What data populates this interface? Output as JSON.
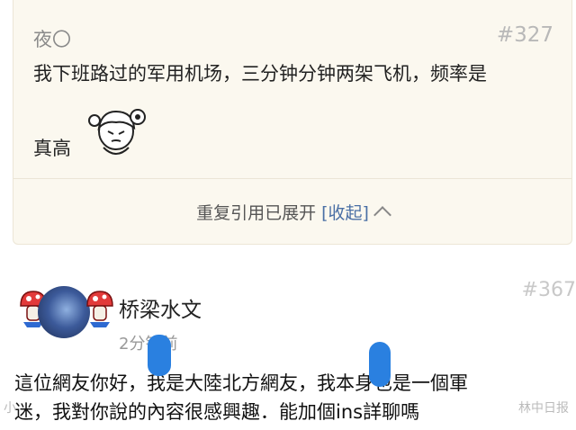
{
  "quote": {
    "user": "夜〇",
    "floor": "#327",
    "line1": "我下班路过的军用机场，三分钟分钟两架飞机，频率是",
    "line2": "真高",
    "toggle_text": "重复引用已展开",
    "collapse_label": "[收起]",
    "sticker_icon": "cartoon-girl-sticker"
  },
  "reply": {
    "user": "桥梁水文",
    "time": "2分钟前",
    "floor": "#367",
    "line1": "這位網友你好，我是大陸北方網友，我本身也是一個軍",
    "line2": "迷，我對你說的內容很感興趣．能加個ins詳聊嗎"
  },
  "watermark": {
    "left": "小",
    "right": "林中日报"
  },
  "colors": {
    "card_bg": "#fbf8ef",
    "link": "#4a6fa5",
    "redaction": "#2a80e0"
  }
}
